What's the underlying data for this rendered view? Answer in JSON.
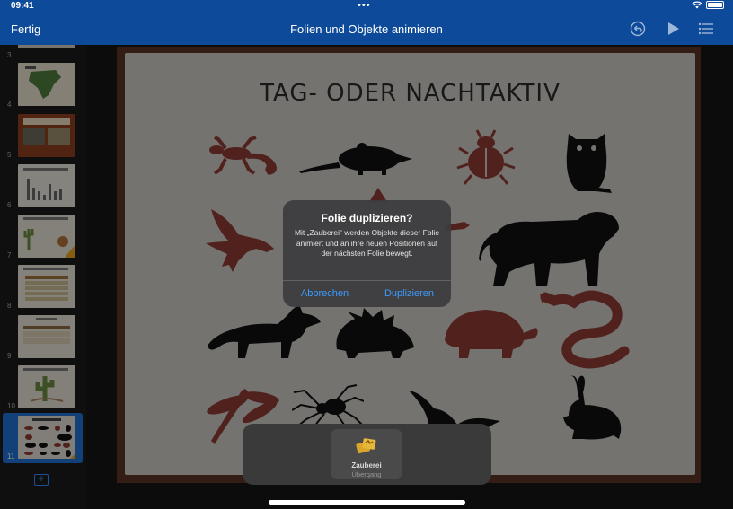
{
  "status": {
    "time": "09:41",
    "dots": "•••"
  },
  "toolbar": {
    "done": "Fertig",
    "title": "Folien und Objekte animieren"
  },
  "sidebar": {
    "slide_numbers": [
      "3",
      "4",
      "5",
      "6",
      "7",
      "8",
      "9",
      "10",
      "11"
    ]
  },
  "slide": {
    "title": "TAG- ODER NACHTAKTIV"
  },
  "alert": {
    "title": "Folie duplizieren?",
    "message": "Mit „Zauberei“ werden Objekte dieser Folie animiert und an ihre neuen Positionen auf der nächsten Folie bewegt.",
    "cancel": "Abbrechen",
    "confirm": "Duplizieren"
  },
  "transition": {
    "name": "Zauberei",
    "subtitle": "Übergang"
  },
  "colors": {
    "toolbar": "#0e4a9a",
    "accent": "#3d9bff",
    "red_animal": "#8c3a32",
    "black_animal": "#111111"
  }
}
